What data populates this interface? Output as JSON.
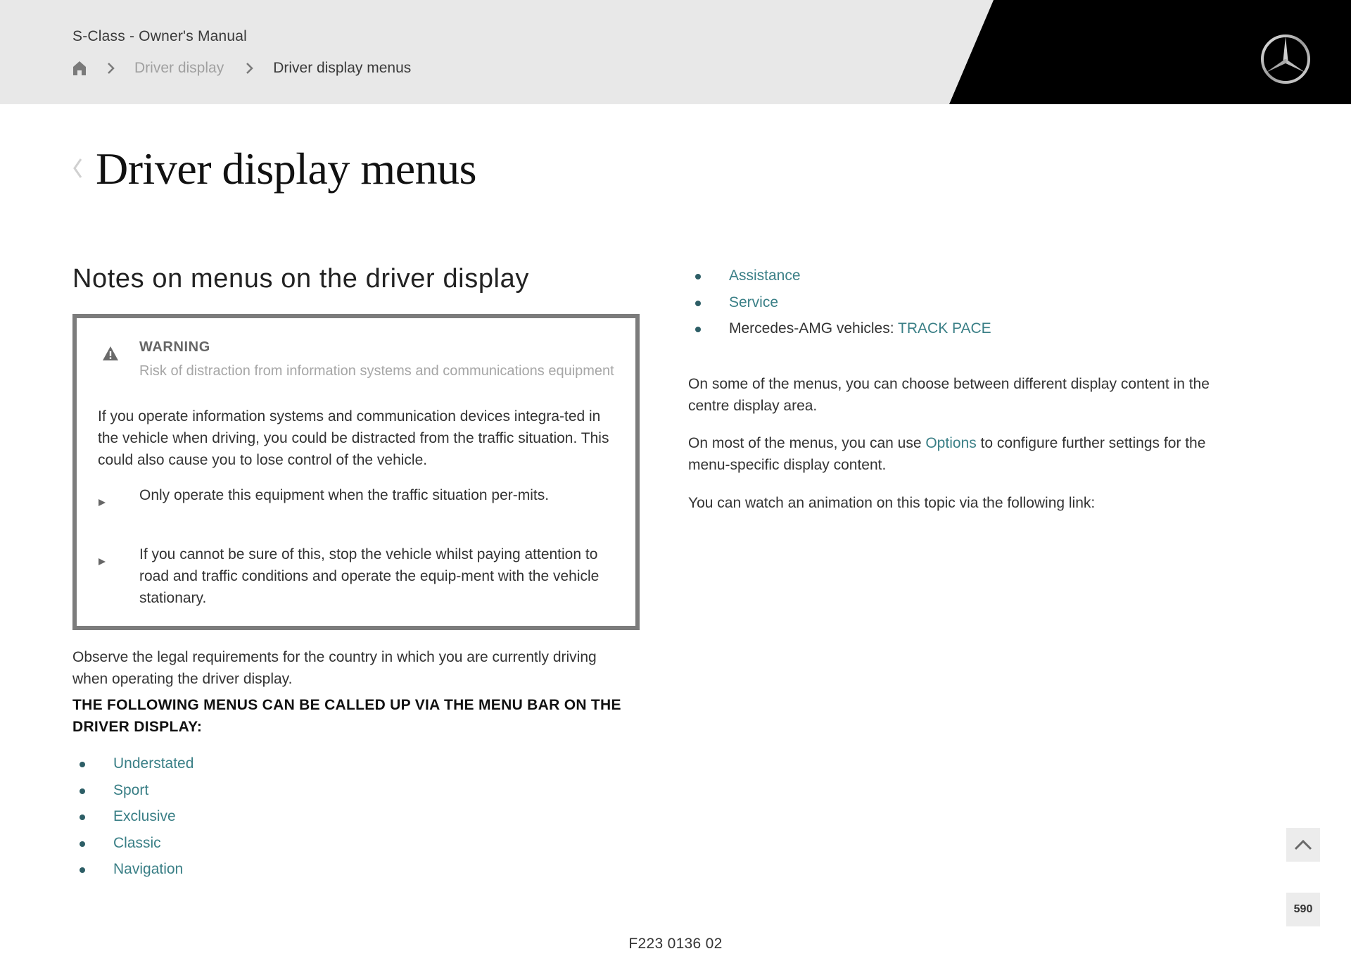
{
  "header": {
    "manual_title": "S-Class - Owner's Manual",
    "breadcrumb": {
      "home_icon": "home-icon",
      "separator_icon": "chevron-right-icon",
      "items": [
        {
          "label": "Driver display",
          "link": true
        },
        {
          "label": "Driver display menus",
          "link": false
        }
      ]
    },
    "logo": "mercedes-star-logo",
    "colors": {
      "bar": "#e8e8e8",
      "brand_block": "#000000"
    }
  },
  "page": {
    "back_icon": "chevron-left-icon",
    "title": "Driver display menus",
    "section_title": "Notes on menus on the driver display"
  },
  "warning": {
    "icon": "warning-triangle-icon",
    "label": "WARNING",
    "subtitle": "Risk of distraction from information systems and communications equipment",
    "body": "If you operate information systems and communication devices integra-ted in the vehicle when driving, you could be distracted from the traffic situation. This could also cause you to lose control of the vehicle.",
    "steps": [
      "Only operate this equipment when the traffic situation per-mits.",
      "If you cannot be sure of this, stop the vehicle whilst paying attention to road and traffic conditions and operate the equip-ment with the vehicle stationary."
    ]
  },
  "left": {
    "legal_note": "Observe the legal requirements for the country in which you are currently driving when operating the driver display.",
    "menus_heading": "THE FOLLOWING MENUS CAN BE CALLED UP VIA THE MENU BAR ON THE DRIVER DISPLAY:",
    "menus": [
      "Understated",
      "Sport",
      "Exclusive",
      "Classic",
      "Navigation"
    ]
  },
  "right": {
    "menus": [
      {
        "prefix": "",
        "link": "Assistance"
      },
      {
        "prefix": "",
        "link": "Service"
      },
      {
        "prefix": "Mercedes-AMG vehicles: ",
        "link": "TRACK PACE"
      }
    ],
    "para1": "On some of the menus, you can choose between different display content in the centre display area.",
    "para2_before": "On most of the menus, you can use ",
    "para2_link": "Options",
    "para2_after": " to configure further settings for the menu-specific display content.",
    "para3": "You can watch an animation on this topic via the following link:"
  },
  "footer": {
    "code": "F223 0136 02",
    "scroll_top_icon": "chevron-up-icon",
    "page_number": "590"
  },
  "colors": {
    "link": "#3a7f86",
    "bullet": "#2d5e66",
    "warning_border": "#7c7c7c"
  }
}
